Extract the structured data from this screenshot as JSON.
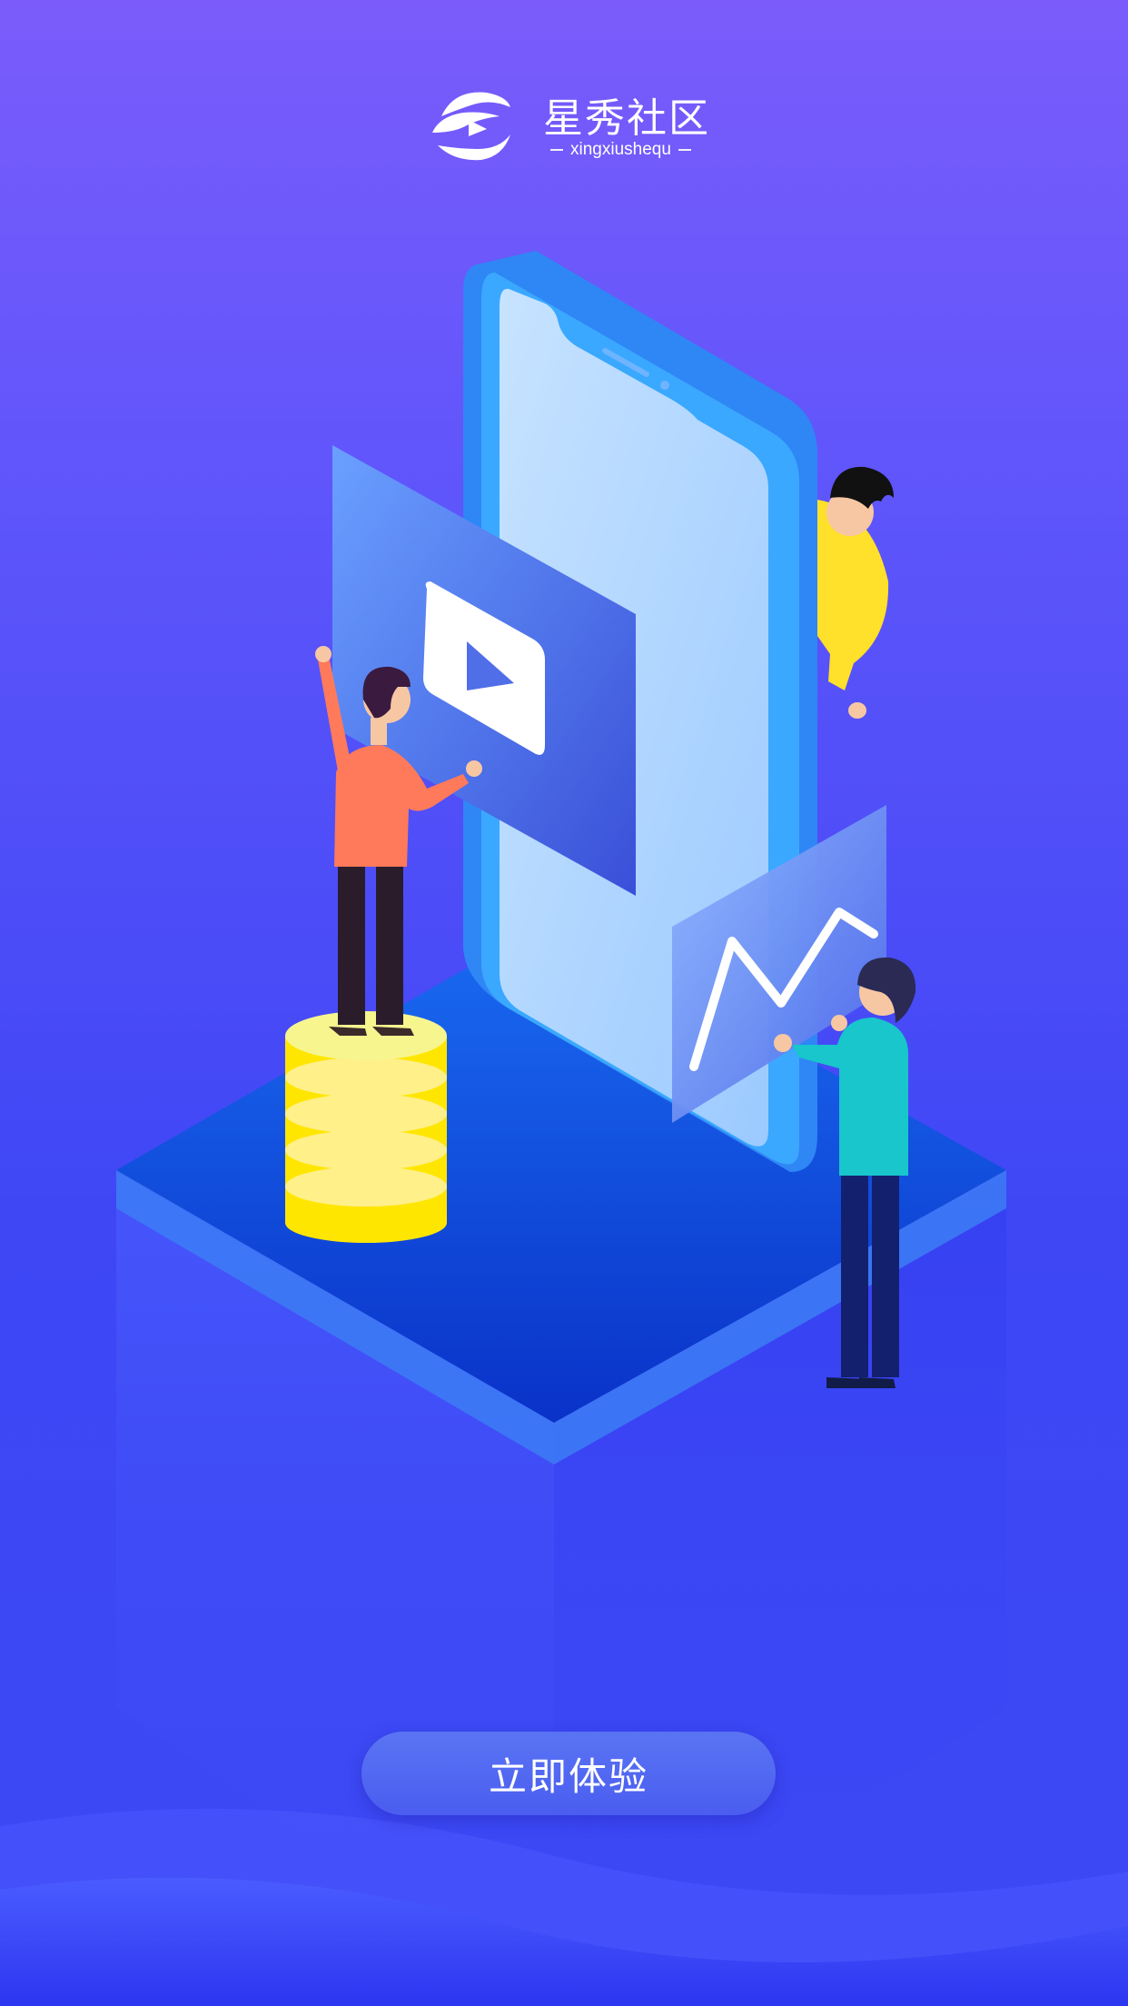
{
  "brand": {
    "title": "星秀社区",
    "subtitle": "xingxiushequ",
    "logo_icon": "play-swirl-logo"
  },
  "cta": {
    "label": "立即体验"
  },
  "illustration": {
    "icons": [
      "play-icon",
      "chart-line-icon",
      "coin-stack",
      "smartphone"
    ]
  },
  "colors": {
    "bg_top": "#7b5cfb",
    "bg_bottom": "#3a48f4",
    "button": "#5066f2",
    "coin": "#ffe600",
    "phone": "#3aa0ff"
  }
}
